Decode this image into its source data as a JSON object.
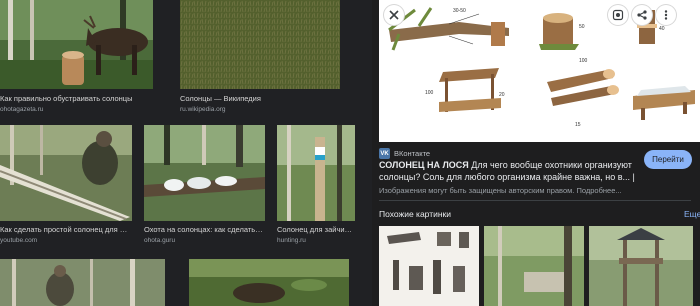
{
  "results": [
    {
      "caption": "Как правильно обустраивать солонцы",
      "source": "ohotagazeta.ru"
    },
    {
      "caption": "Солонцы — Википедия",
      "source": "ru.wikipedia.org"
    },
    {
      "caption": "Как сделать простой солонец для лося ...",
      "source": "youtube.com"
    },
    {
      "caption": "Охота на солонцах: как сделать со...",
      "source": "ohota.guru"
    },
    {
      "caption": "Солонец для зайчико...",
      "source": "hunting.ru"
    }
  ],
  "preview": {
    "site_name": "ВКонтакте",
    "site_badge": "VK",
    "title_bold": "СОЛОНЕЦ НА ЛОСЯ",
    "title_rest": " Для чего вообще охотники организуют солонцы? Соль для любого организма крайне важна, но в... |",
    "visit_label": "Перейти",
    "copyright_note": "Изображения могут быть защищены авторским правом.",
    "copyright_more": "Подробнее...",
    "similar_heading": "Похожие картинки",
    "similar_all": "Еще",
    "close_icon": "close-icon",
    "lens_icon": "lens-icon",
    "share_icon": "share-icon",
    "more_icon": "more-vert-icon",
    "diagram_labels": [
      "30-50",
      "50",
      "40",
      "100",
      "20",
      "100",
      "15"
    ]
  },
  "colors": {
    "page_bg": "#202124",
    "panel_bg": "#1e1e1f",
    "accent": "#8ab4f8",
    "vk": "#4a76a8"
  }
}
